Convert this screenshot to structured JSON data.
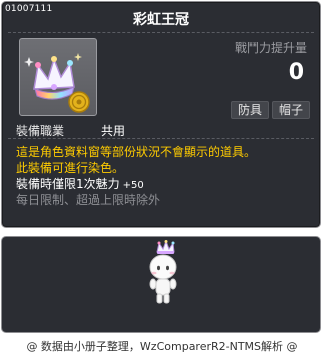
{
  "item": {
    "id": "01007111",
    "name": "彩虹王冠",
    "icon": "rainbow-crown-icon",
    "boost_label": "戰鬥力提升量",
    "boost_value": "0",
    "tags": [
      "防具",
      "帽子"
    ],
    "job_label": "裝備職業",
    "job_value": "共用"
  },
  "description": {
    "line1": "這是角色資料窗等部份狀況不會顯示的道具。",
    "line2": "此裝備可進行染色。",
    "line3": "裝備時僅限1次魅力",
    "line3_bonus": "+50",
    "line4": "每日限制、超過上限時除外"
  },
  "preview": {
    "avatar": "character-avatar-preview"
  },
  "footer": {
    "text": "@ 数据由小册子整理，WzComparerR2-NTMS解析 @"
  },
  "colors": {
    "panel_bg": "#2b2d33",
    "panel_border": "#8e8e92",
    "highlight_text": "#ffcc00",
    "muted_text": "#8e8f94"
  }
}
